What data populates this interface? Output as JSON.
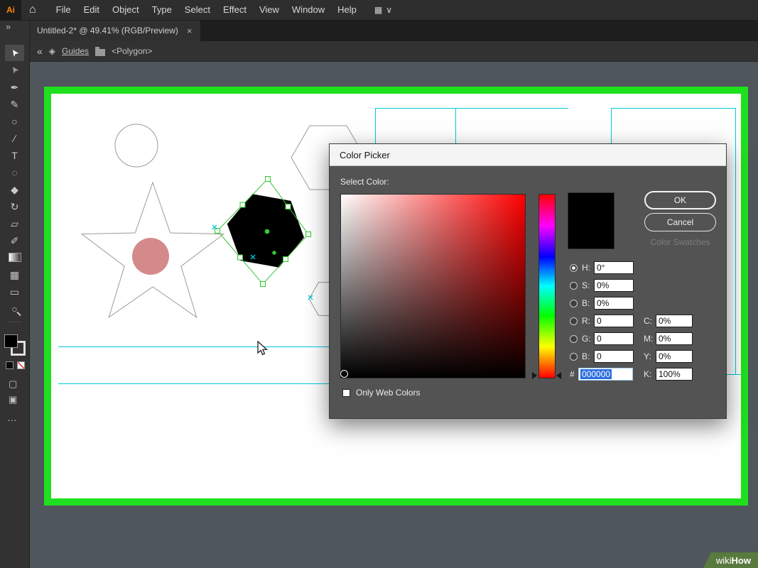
{
  "menu_bar": {
    "app_icon": "Ai",
    "home_icon": "⌂",
    "items": [
      "File",
      "Edit",
      "Object",
      "Type",
      "Select",
      "Effect",
      "View",
      "Window",
      "Help"
    ],
    "workspace_icon": "▦",
    "workspace_chevron": "∨"
  },
  "tab_bar": {
    "title": "Untitled-2* @ 49.41% (RGB/Preview)",
    "close_icon": "×"
  },
  "control_bar": {
    "back_icon": "«",
    "layers_icon": "◈",
    "guides_label": "Guides",
    "path_label": "<Polygon>"
  },
  "toolbar": {
    "collapse_icon": "»",
    "more_icon": "…",
    "mode_a_icon": "▢",
    "mode_b_icon": "▣",
    "tools": [
      {
        "name": "selection-tool",
        "glyph": "➤"
      },
      {
        "name": "direct-selection-tool",
        "glyph": "➤"
      },
      {
        "name": "pen-tool",
        "glyph": "✒"
      },
      {
        "name": "curvature-tool",
        "glyph": "✎"
      },
      {
        "name": "ellipse-tool",
        "glyph": "○"
      },
      {
        "name": "line-segment-tool",
        "glyph": "∕"
      },
      {
        "name": "type-tool",
        "glyph": "T"
      },
      {
        "name": "polygon-tool",
        "glyph": "◌"
      },
      {
        "name": "eraser-tool",
        "glyph": "◆"
      },
      {
        "name": "rotate-tool",
        "glyph": "↻"
      },
      {
        "name": "scale-tool",
        "glyph": "▱"
      },
      {
        "name": "eyedropper-tool",
        "glyph": "✐"
      },
      {
        "name": "gradient-tool",
        "glyph": ""
      },
      {
        "name": "mesh-tool",
        "glyph": "▦"
      },
      {
        "name": "artboard-tool",
        "glyph": "▭"
      },
      {
        "name": "zoom-tool",
        "glyph": "○"
      }
    ]
  },
  "dialog": {
    "title": "Color Picker",
    "select_color": "Select Color:",
    "buttons": {
      "ok": "OK",
      "cancel": "Cancel",
      "color_swatches": "Color Swatches"
    },
    "left_fields": [
      {
        "label": "H:",
        "value": "0°"
      },
      {
        "label": "S:",
        "value": "0%"
      },
      {
        "label": "B:",
        "value": "0%"
      },
      {
        "label": "R:",
        "value": "0"
      },
      {
        "label": "G:",
        "value": "0"
      },
      {
        "label": "B:",
        "value": "0"
      }
    ],
    "right_fields": [
      {
        "label": "C:",
        "value": "0%"
      },
      {
        "label": "M:",
        "value": "0%"
      },
      {
        "label": "Y:",
        "value": "0%"
      },
      {
        "label": "K:",
        "value": "100%"
      }
    ],
    "hex": {
      "label": "#",
      "value": "000000"
    },
    "only_web_colors": "Only Web Colors"
  },
  "watermark": {
    "wiki": "wiki",
    "how": "How"
  },
  "colors": {
    "highlight-green": "#1fe01f",
    "selection-green": "#3ac43a",
    "guide-cyan": "#00c9de",
    "pink": "#d48a8a",
    "hex-selection": "#2f6fe0",
    "dialog-bg": "#535353"
  }
}
